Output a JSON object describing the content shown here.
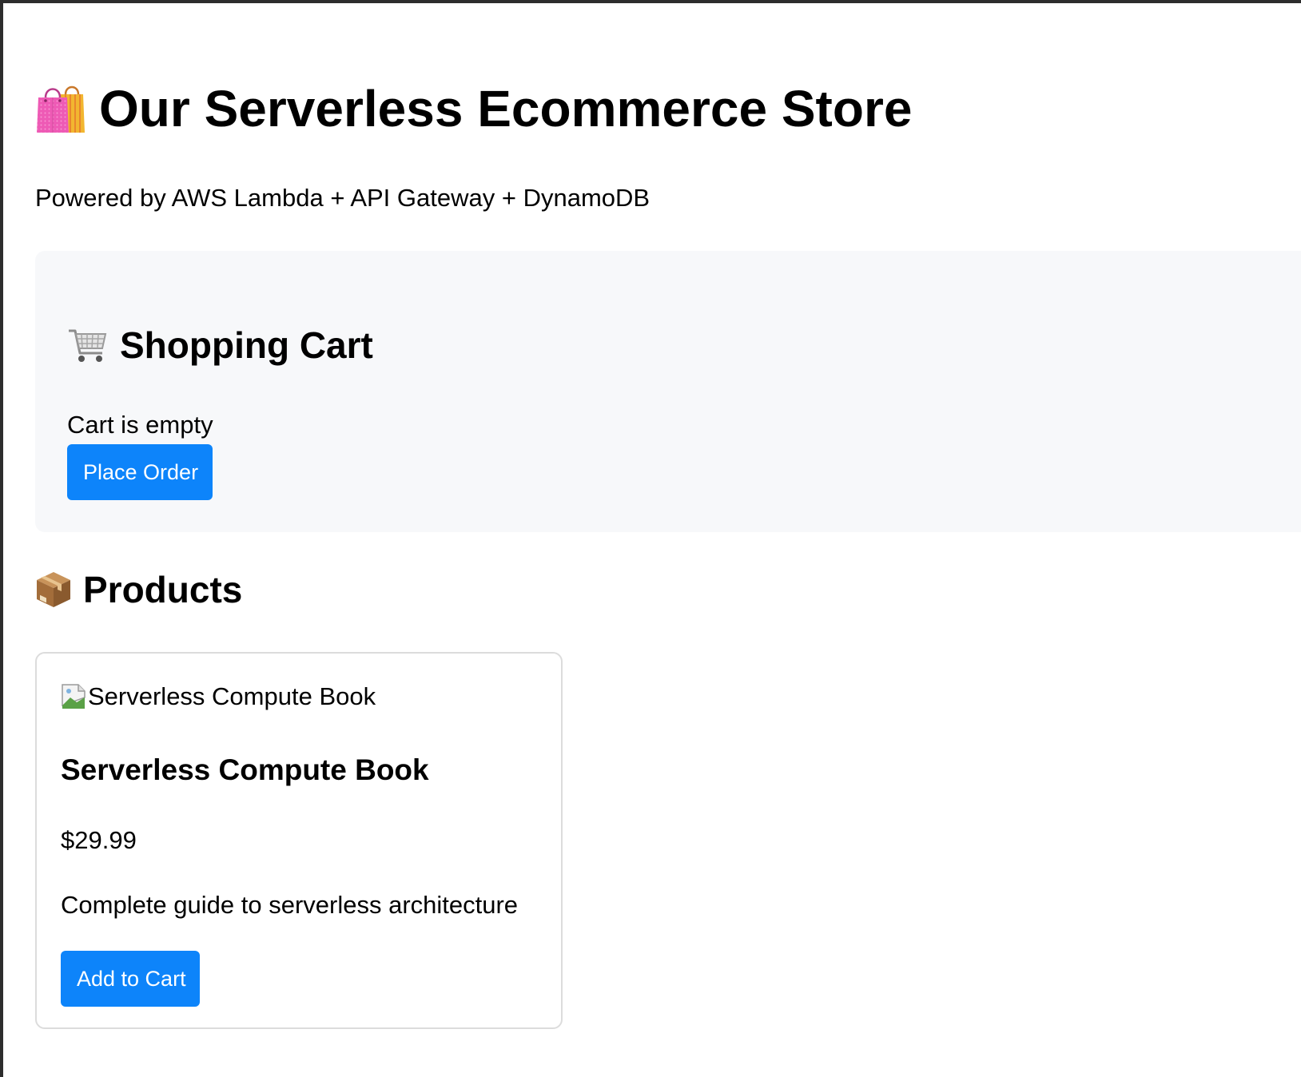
{
  "header": {
    "title": "Our Serverless Ecommerce Store",
    "title_icon": "shopping-bags-icon",
    "subtitle": "Powered by AWS Lambda + API Gateway + DynamoDB"
  },
  "cart": {
    "heading": "Shopping Cart",
    "heading_icon": "shopping-cart-icon",
    "status": "Cart is empty",
    "place_order_label": "Place Order"
  },
  "products": {
    "heading": "Products",
    "heading_icon": "package-icon",
    "items": [
      {
        "image_alt": "Serverless Compute Book",
        "name": "Serverless Compute Book",
        "price": "$29.99",
        "description": "Complete guide to serverless architecture",
        "add_label": "Add to Cart"
      }
    ]
  },
  "colors": {
    "accent": "#0d84fa",
    "panel_background": "#f7f8fa",
    "card_border": "#dcdcdc"
  }
}
